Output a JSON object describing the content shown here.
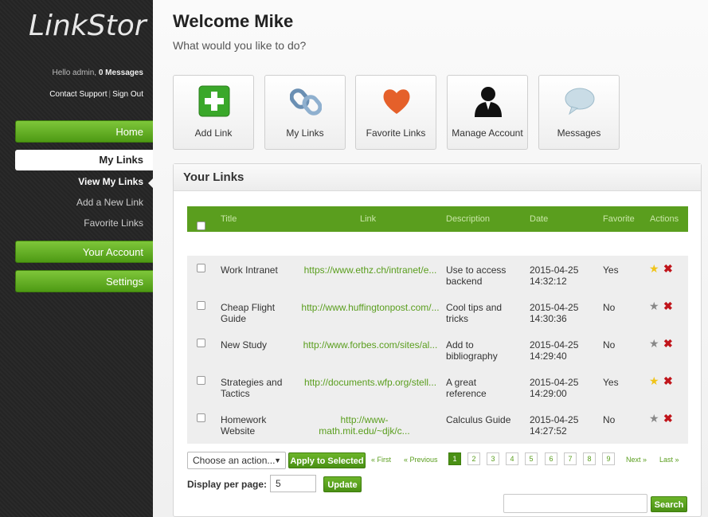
{
  "app": {
    "logo": "LinkStor"
  },
  "user": {
    "greeting": "Hello admin,",
    "messages": "0 Messages",
    "support": "Contact Support",
    "signout": "Sign Out"
  },
  "nav": {
    "home": "Home",
    "my_links": "My Links",
    "sub": [
      "View My Links",
      "Add a New Link",
      "Favorite Links"
    ],
    "your_account": "Your Account",
    "settings": "Settings"
  },
  "header": {
    "title": "Welcome Mike",
    "subtitle": "What would you like to do?"
  },
  "tiles": [
    {
      "label": "Add Link",
      "icon": "plus-icon"
    },
    {
      "label": "My Links",
      "icon": "chain-link-icon"
    },
    {
      "label": "Favorite Links",
      "icon": "heart-icon"
    },
    {
      "label": "Manage Account",
      "icon": "user-icon"
    },
    {
      "label": "Messages",
      "icon": "speech-bubble-icon"
    }
  ],
  "panel": {
    "title": "Your Links"
  },
  "table": {
    "columns": [
      "Title",
      "Link",
      "Description",
      "Date",
      "Favorite",
      "Actions"
    ],
    "rows": [
      {
        "title": "Work Intranet",
        "link": "https://www.ethz.ch/intranet/e...",
        "description": "Use to access backend",
        "date": "2015-04-25 14:32:12",
        "favorite": "Yes",
        "starred": true
      },
      {
        "title": "Cheap Flight Guide",
        "link": "http://www.huffingtonpost.com/...",
        "description": "Cool tips and tricks",
        "date": "2015-04-25 14:30:36",
        "favorite": "No",
        "starred": false
      },
      {
        "title": "New Study",
        "link": "http://www.forbes.com/sites/al...",
        "description": "Add to bibliography",
        "date": "2015-04-25 14:29:40",
        "favorite": "No",
        "starred": false
      },
      {
        "title": "Strategies and Tactics",
        "link": "http://documents.wfp.org/stell...",
        "description": "A great reference",
        "date": "2015-04-25 14:29:00",
        "favorite": "Yes",
        "starred": true
      },
      {
        "title": "Homework Website",
        "link": "http://www-math.mit.edu/~djk/c...",
        "description": "Calculus Guide",
        "date": "2015-04-25 14:27:52",
        "favorite": "No",
        "starred": false
      }
    ]
  },
  "bulk": {
    "select_value": "Choose an action...",
    "apply": "Apply to Selected"
  },
  "pager": {
    "first": "« First",
    "prev": "« Previous",
    "pages": [
      "1",
      "2",
      "3",
      "4",
      "5",
      "6",
      "7",
      "8",
      "9"
    ],
    "active_page": "1",
    "next": "Next »",
    "last": "Last »"
  },
  "display": {
    "label": "Display per page:",
    "value": "5",
    "update": "Update"
  },
  "search": {
    "value": "",
    "button": "Search"
  },
  "colors": {
    "accent": "#5a9e1e",
    "sidebar": "#262626",
    "delete": "#c0151b",
    "star": "#f0c419"
  }
}
